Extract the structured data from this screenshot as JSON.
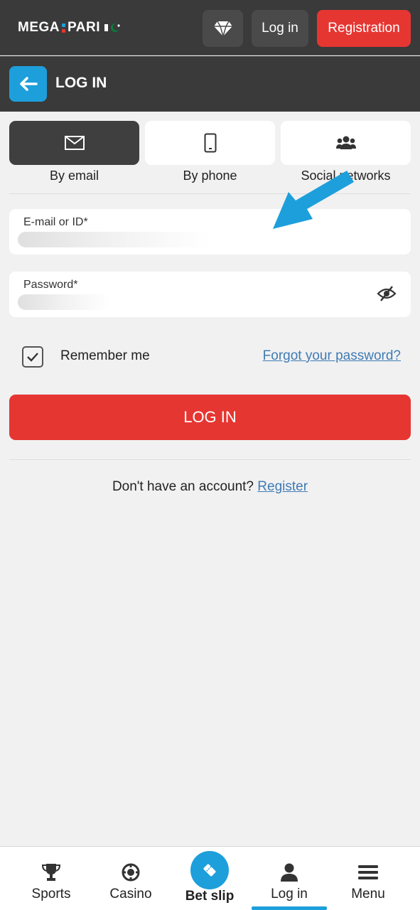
{
  "colors": {
    "accent": "#1d9fdb",
    "danger": "#e63632",
    "header_bg": "#3a3a3a",
    "link": "#3f7bb3"
  },
  "header": {
    "logo_left": "MEGA",
    "logo_right": "PARI",
    "diamond_icon": "diamond-icon",
    "login_label": "Log in",
    "register_label": "Registration"
  },
  "titlebar": {
    "back_icon": "arrow-left-icon",
    "title": "LOG IN"
  },
  "methods": [
    {
      "label": "By email",
      "icon": "envelope-icon",
      "active": true
    },
    {
      "label": "By phone",
      "icon": "phone-icon",
      "active": false
    },
    {
      "label": "Social networks",
      "icon": "users-icon",
      "active": false
    }
  ],
  "form": {
    "email_label": "E-mail or ID*",
    "password_label": "Password*",
    "remember_label": "Remember me",
    "remember_checked": true,
    "forgot_label": "Forgot your password?",
    "submit_label": "LOG IN"
  },
  "footer_prompt": {
    "text": "Don't have an account?",
    "link": "Register"
  },
  "bottom_nav": [
    {
      "label": "Sports",
      "icon": "trophy-icon"
    },
    {
      "label": "Casino",
      "icon": "casino-chip-icon"
    },
    {
      "label": "Bet slip",
      "icon": "ticket-icon"
    },
    {
      "label": "Log in",
      "icon": "user-icon",
      "active": true
    },
    {
      "label": "Menu",
      "icon": "hamburger-icon"
    }
  ]
}
